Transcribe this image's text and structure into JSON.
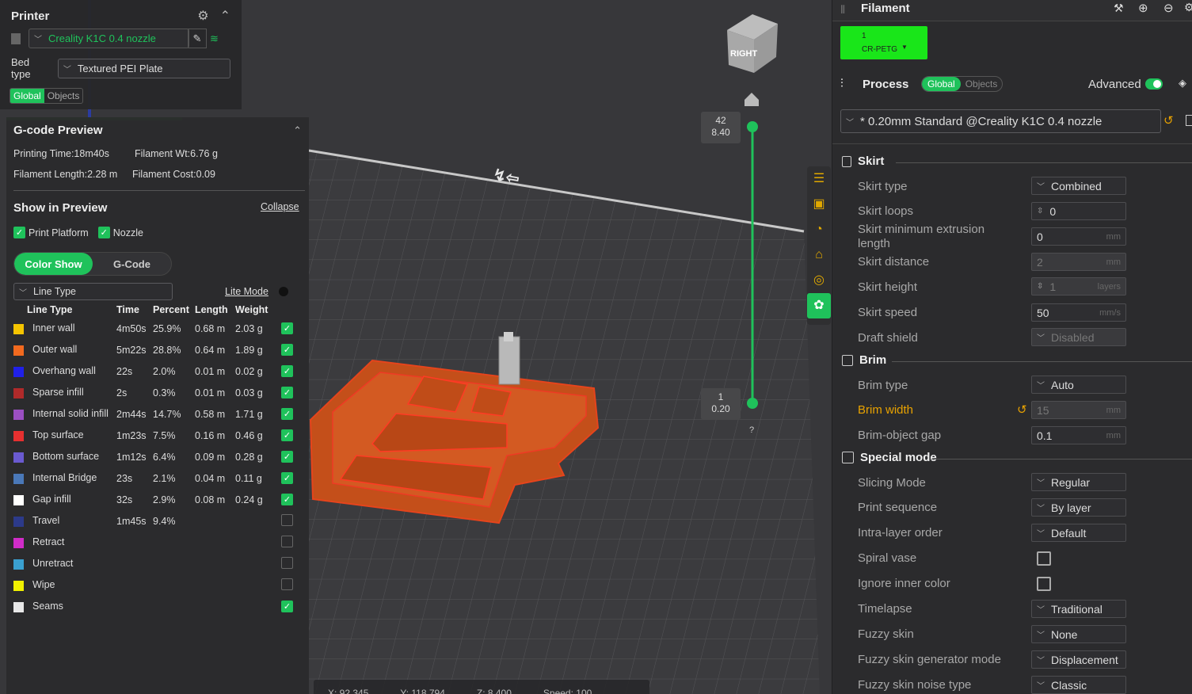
{
  "printer": {
    "title": "Printer",
    "name": "Creality K1C 0.4 nozzle",
    "bed_label": "Bed type",
    "bed_value": "Textured PEI Plate",
    "scope_tabs": [
      "Global",
      "Objects"
    ]
  },
  "gcode": {
    "title": "G-code Preview",
    "printing_time": "Printing Time:18m40s",
    "filament_wt": "Filament Wt:6.76 g",
    "filament_length": "Filament Length:2.28 m",
    "filament_cost": "Filament Cost:0.09",
    "show_title": "Show in Preview",
    "collapse": "Collapse",
    "print_platform": "Print Platform",
    "nozzle": "Nozzle",
    "tab_color": "Color Show",
    "tab_gcode": "G-Code",
    "view_select": "Line Type",
    "lite_mode": "Lite Mode",
    "headers": [
      "Line Type",
      "Time",
      "Percent",
      "Length",
      "Weight"
    ],
    "rows": [
      {
        "name": "Inner wall",
        "color": "#f5c400",
        "time": "4m50s",
        "percent": "25.9%",
        "length": "0.68 m",
        "weight": "2.03 g",
        "checked": true
      },
      {
        "name": "Outer wall",
        "color": "#f26a1f",
        "time": "5m22s",
        "percent": "28.8%",
        "length": "0.64 m",
        "weight": "1.89 g",
        "checked": true
      },
      {
        "name": "Overhang wall",
        "color": "#2020e8",
        "time": "22s",
        "percent": "2.0%",
        "length": "0.01 m",
        "weight": "0.02 g",
        "checked": true
      },
      {
        "name": "Sparse infill",
        "color": "#b02a2a",
        "time": "2s",
        "percent": "0.3%",
        "length": "0.01 m",
        "weight": "0.03 g",
        "checked": true
      },
      {
        "name": "Internal solid infill",
        "color": "#9b4fc2",
        "time": "2m44s",
        "percent": "14.7%",
        "length": "0.58 m",
        "weight": "1.71 g",
        "checked": true
      },
      {
        "name": "Top surface",
        "color": "#e63030",
        "time": "1m23s",
        "percent": "7.5%",
        "length": "0.16 m",
        "weight": "0.46 g",
        "checked": true
      },
      {
        "name": "Bottom surface",
        "color": "#6a5ad0",
        "time": "1m12s",
        "percent": "6.4%",
        "length": "0.09 m",
        "weight": "0.28 g",
        "checked": true
      },
      {
        "name": "Internal Bridge",
        "color": "#4a78b8",
        "time": "23s",
        "percent": "2.1%",
        "length": "0.04 m",
        "weight": "0.11 g",
        "checked": true
      },
      {
        "name": "Gap infill",
        "color": "#ffffff",
        "time": "32s",
        "percent": "2.9%",
        "length": "0.08 m",
        "weight": "0.24 g",
        "checked": true
      },
      {
        "name": "Travel",
        "color": "#2c3a8a",
        "time": "1m45s",
        "percent": "9.4%",
        "length": "",
        "weight": "",
        "checked": false
      },
      {
        "name": "Retract",
        "color": "#d02cc8",
        "time": "",
        "percent": "",
        "length": "",
        "weight": "",
        "checked": false
      },
      {
        "name": "Unretract",
        "color": "#3aa0d0",
        "time": "",
        "percent": "",
        "length": "",
        "weight": "",
        "checked": false
      },
      {
        "name": "Wipe",
        "color": "#f0f000",
        "time": "",
        "percent": "",
        "length": "",
        "weight": "",
        "checked": false
      },
      {
        "name": "Seams",
        "color": "#e8e8e8",
        "time": "",
        "percent": "",
        "length": "",
        "weight": "",
        "checked": true
      }
    ]
  },
  "viewport": {
    "cube_label": "RIGHT",
    "layer_top": "42",
    "height_top": "8.40",
    "layer_bottom": "1",
    "height_bottom": "0.20",
    "help": "?",
    "coords": [
      "X: 92.345",
      "Y: 118.794",
      "Z: 8.400",
      "Speed: 100"
    ]
  },
  "filament": {
    "title": "Filament",
    "slot_number": "1",
    "slot_name": "CR-PETG",
    "slot_color": "#19e619"
  },
  "process": {
    "title": "Process",
    "scope_tabs": [
      "Global",
      "Objects"
    ],
    "advanced_label": "Advanced",
    "preset": "* 0.20mm Standard @Creality K1C 0.4 nozzle"
  },
  "sections": {
    "skirt": "Skirt",
    "brim": "Brim",
    "special": "Special mode"
  },
  "params": {
    "skirt_type": {
      "label": "Skirt type",
      "value": "Combined"
    },
    "skirt_loops": {
      "label": "Skirt loops",
      "value": "0"
    },
    "skirt_min_ext": {
      "label": "Skirt minimum extrusion length",
      "value": "0",
      "unit": "mm"
    },
    "skirt_distance": {
      "label": "Skirt distance",
      "value": "2",
      "unit": "mm"
    },
    "skirt_height": {
      "label": "Skirt height",
      "value": "1",
      "unit": "layers"
    },
    "skirt_speed": {
      "label": "Skirt speed",
      "value": "50",
      "unit": "mm/s"
    },
    "draft_shield": {
      "label": "Draft shield",
      "value": "Disabled"
    },
    "brim_type": {
      "label": "Brim type",
      "value": "Auto"
    },
    "brim_width": {
      "label": "Brim width",
      "value": "15",
      "unit": "mm"
    },
    "brim_gap": {
      "label": "Brim-object gap",
      "value": "0.1",
      "unit": "mm"
    },
    "slicing_mode": {
      "label": "Slicing Mode",
      "value": "Regular"
    },
    "print_sequence": {
      "label": "Print sequence",
      "value": "By layer"
    },
    "intra_layer": {
      "label": "Intra-layer order",
      "value": "Default"
    },
    "spiral_vase": {
      "label": "Spiral vase"
    },
    "ignore_inner": {
      "label": "Ignore inner color"
    },
    "timelapse": {
      "label": "Timelapse",
      "value": "Traditional"
    },
    "fuzzy_skin": {
      "label": "Fuzzy skin",
      "value": "None"
    },
    "fuzzy_gen": {
      "label": "Fuzzy skin generator mode",
      "value": "Displacement"
    },
    "fuzzy_noise": {
      "label": "Fuzzy skin noise type",
      "value": "Classic"
    }
  },
  "colors": {
    "accent": "#1fc25b",
    "warning": "#e8a200",
    "model": "#c8501c"
  }
}
